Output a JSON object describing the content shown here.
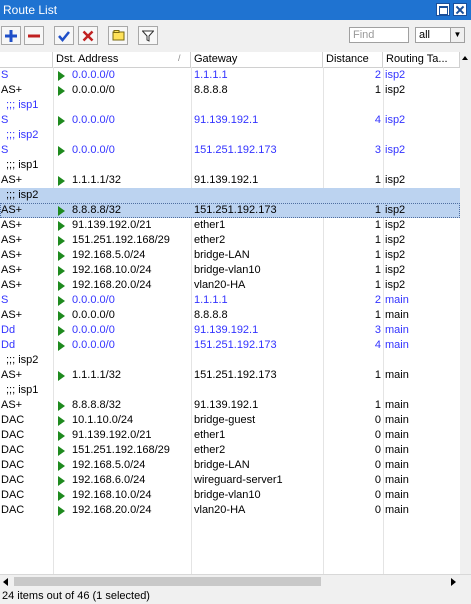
{
  "window": {
    "title": "Route List"
  },
  "toolbar": {
    "buttons": [
      {
        "name": "add-button",
        "icon": "plus-icon"
      },
      {
        "name": "remove-button",
        "icon": "minus-icon"
      },
      {
        "name": "enable-button",
        "icon": "check-icon"
      },
      {
        "name": "disable-button",
        "icon": "x-icon"
      },
      {
        "name": "comment-button",
        "icon": "note-icon"
      },
      {
        "name": "filter-button",
        "icon": "filter-icon"
      }
    ],
    "find_placeholder": "Find",
    "filter_select": "all"
  },
  "columns": [
    "",
    "Dst. Address",
    "Gateway",
    "Distance",
    "Routing Ta..."
  ],
  "rows": [
    {
      "type": "route",
      "flags": "S",
      "dst": "0.0.0.0/0",
      "gateway": "1.1.1.1",
      "distance": "2",
      "table": "isp2",
      "blue": true
    },
    {
      "type": "route",
      "flags": "AS+",
      "dst": "0.0.0.0/0",
      "gateway": "8.8.8.8",
      "distance": "1",
      "table": "isp2",
      "blue": false
    },
    {
      "type": "comment",
      "text": ";;; isp1",
      "blue": true
    },
    {
      "type": "route",
      "flags": "S",
      "dst": "0.0.0.0/0",
      "gateway": "91.139.192.1",
      "distance": "4",
      "table": "isp2",
      "blue": true
    },
    {
      "type": "comment",
      "text": ";;; isp2",
      "blue": true
    },
    {
      "type": "route",
      "flags": "S",
      "dst": "0.0.0.0/0",
      "gateway": "151.251.192.173",
      "distance": "3",
      "table": "isp2",
      "blue": true
    },
    {
      "type": "comment",
      "text": ";;; isp1",
      "blue": false
    },
    {
      "type": "route",
      "flags": "AS+",
      "dst": "1.1.1.1/32",
      "gateway": "91.139.192.1",
      "distance": "1",
      "table": "isp2",
      "blue": false
    },
    {
      "type": "comment",
      "text": ";;; isp2",
      "blue": false,
      "selected": true
    },
    {
      "type": "route",
      "flags": "AS+",
      "dst": "8.8.8.8/32",
      "gateway": "151.251.192.173",
      "distance": "1",
      "table": "isp2",
      "blue": false,
      "selected": true
    },
    {
      "type": "route",
      "flags": "AS+",
      "dst": "91.139.192.0/21",
      "gateway": "ether1",
      "distance": "1",
      "table": "isp2",
      "blue": false
    },
    {
      "type": "route",
      "flags": "AS+",
      "dst": "151.251.192.168/29",
      "gateway": "ether2",
      "distance": "1",
      "table": "isp2",
      "blue": false
    },
    {
      "type": "route",
      "flags": "AS+",
      "dst": "192.168.5.0/24",
      "gateway": "bridge-LAN",
      "distance": "1",
      "table": "isp2",
      "blue": false
    },
    {
      "type": "route",
      "flags": "AS+",
      "dst": "192.168.10.0/24",
      "gateway": "bridge-vlan10",
      "distance": "1",
      "table": "isp2",
      "blue": false
    },
    {
      "type": "route",
      "flags": "AS+",
      "dst": "192.168.20.0/24",
      "gateway": "vlan20-HA",
      "distance": "1",
      "table": "isp2",
      "blue": false
    },
    {
      "type": "route",
      "flags": "S",
      "dst": "0.0.0.0/0",
      "gateway": "1.1.1.1",
      "distance": "2",
      "table": "main",
      "blue": true
    },
    {
      "type": "route",
      "flags": "AS+",
      "dst": "0.0.0.0/0",
      "gateway": "8.8.8.8",
      "distance": "1",
      "table": "main",
      "blue": false
    },
    {
      "type": "route",
      "flags": "Dd",
      "dst": "0.0.0.0/0",
      "gateway": "91.139.192.1",
      "distance": "3",
      "table": "main",
      "blue": true
    },
    {
      "type": "route",
      "flags": "Dd",
      "dst": "0.0.0.0/0",
      "gateway": "151.251.192.173",
      "distance": "4",
      "table": "main",
      "blue": true
    },
    {
      "type": "comment",
      "text": ";;; isp2",
      "blue": false
    },
    {
      "type": "route",
      "flags": "AS+",
      "dst": "1.1.1.1/32",
      "gateway": "151.251.192.173",
      "distance": "1",
      "table": "main",
      "blue": false
    },
    {
      "type": "comment",
      "text": ";;; isp1",
      "blue": false
    },
    {
      "type": "route",
      "flags": "AS+",
      "dst": "8.8.8.8/32",
      "gateway": "91.139.192.1",
      "distance": "1",
      "table": "main",
      "blue": false
    },
    {
      "type": "route",
      "flags": "DAC",
      "dst": "10.1.10.0/24",
      "gateway": "bridge-guest",
      "distance": "0",
      "table": "main",
      "blue": false
    },
    {
      "type": "route",
      "flags": "DAC",
      "dst": "91.139.192.0/21",
      "gateway": "ether1",
      "distance": "0",
      "table": "main",
      "blue": false
    },
    {
      "type": "route",
      "flags": "DAC",
      "dst": "151.251.192.168/29",
      "gateway": "ether2",
      "distance": "0",
      "table": "main",
      "blue": false
    },
    {
      "type": "route",
      "flags": "DAC",
      "dst": "192.168.5.0/24",
      "gateway": "bridge-LAN",
      "distance": "0",
      "table": "main",
      "blue": false
    },
    {
      "type": "route",
      "flags": "DAC",
      "dst": "192.168.6.0/24",
      "gateway": "wireguard-server1",
      "distance": "0",
      "table": "main",
      "blue": false
    },
    {
      "type": "route",
      "flags": "DAC",
      "dst": "192.168.10.0/24",
      "gateway": "bridge-vlan10",
      "distance": "0",
      "table": "main",
      "blue": false
    },
    {
      "type": "route",
      "flags": "DAC",
      "dst": "192.168.20.0/24",
      "gateway": "vlan20-HA",
      "distance": "0",
      "table": "main",
      "blue": false
    }
  ],
  "status": "24 items out of 46 (1 selected)"
}
